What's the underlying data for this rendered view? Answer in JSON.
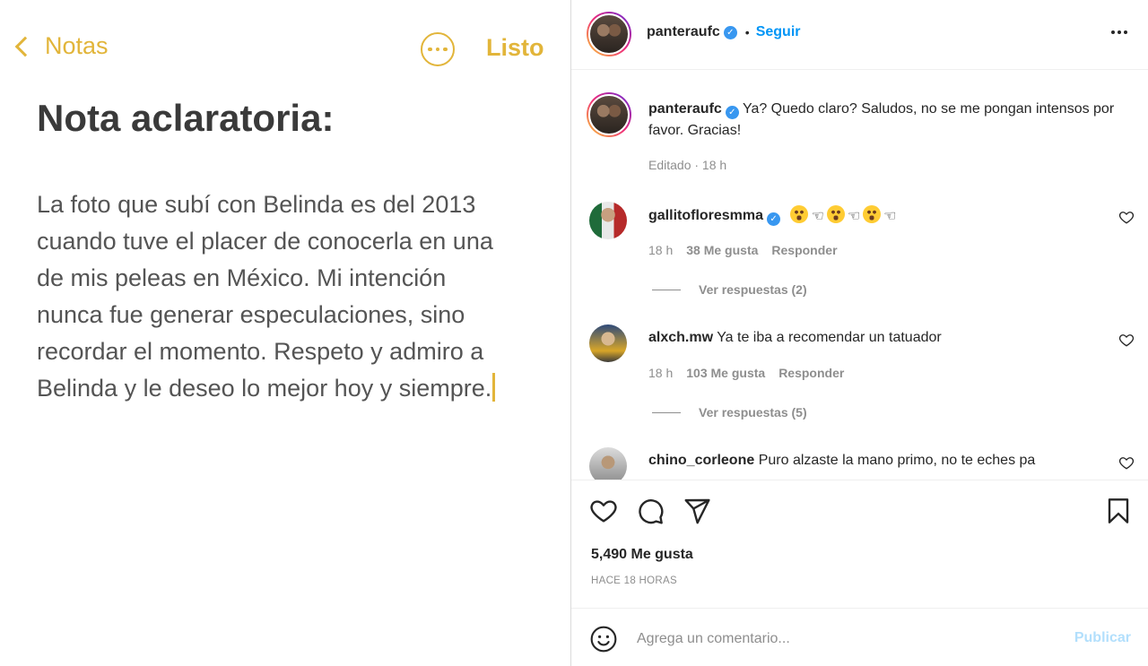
{
  "notes": {
    "back_label": "Notas",
    "done_label": "Listo",
    "title": "Nota aclaratoria:",
    "body_lines": [
      "La foto que subí con Belinda es del 2013",
      "cuando tuve el placer de conocerla en una",
      "de mis peleas en México. Mi intención",
      "nunca fue generar especulaciones, sino",
      "recordar el momento. Respeto y admiro a",
      "Belinda y le deseo lo mejor hoy y siempre."
    ],
    "accent_color": "#e2b53a"
  },
  "post": {
    "author": "panteraufc",
    "follow_label": "Seguir",
    "caption": "Ya? Quedo claro? Saludos, no se me pongan intensos por favor. Gracias!",
    "caption_meta": "Editado · 18 h",
    "likes_total": "5,490 Me gusta",
    "time_ago": "HACE 18 HORAS",
    "comment_placeholder": "Agrega un comentario...",
    "publish_label": "Publicar",
    "accent_color": "#0095f6"
  },
  "comments": [
    {
      "user": "gallitofloresmma",
      "verified": true,
      "text": "",
      "emoji_sequence": [
        "astonished-emoji",
        "point-left",
        "astonished-emoji",
        "point-left",
        "astonished-emoji",
        "point-left"
      ],
      "time": "18 h",
      "likes": "38 Me gusta",
      "reply": "Responder",
      "view_replies": "Ver respuestas (2)"
    },
    {
      "user": "alxch.mw",
      "verified": false,
      "text": "Ya te iba a recomendar un tatuador",
      "time": "18 h",
      "likes": "103 Me gusta",
      "reply": "Responder",
      "view_replies": "Ver respuestas (5)"
    },
    {
      "user": "chino_corleone",
      "verified": false,
      "text": "Puro alzaste la mano primo, no te eches pa"
    }
  ]
}
